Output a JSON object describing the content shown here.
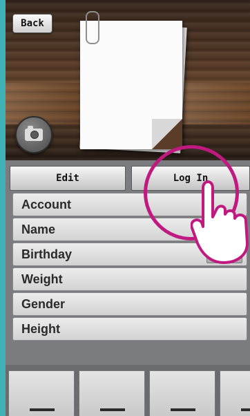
{
  "header": {
    "back_label": "Back",
    "icons": {
      "camera": "camera-icon",
      "paperclip": "paperclip-icon"
    }
  },
  "tabs": {
    "edit_label": "Edit",
    "login_label": "Log In"
  },
  "info_rows": [
    {
      "label": "Account"
    },
    {
      "label": "Name"
    },
    {
      "label": "Birthday",
      "has_toggle": true
    },
    {
      "label": "Weight"
    },
    {
      "label": "Gender"
    },
    {
      "label": "Height"
    }
  ],
  "bottom_tabs": [
    "tab-1",
    "tab-2",
    "tab-3",
    "tab-4"
  ],
  "overlay": {
    "highlight_color": "#c0197f",
    "icon": "tap-hand-icon"
  },
  "colors": {
    "frame_accent": "#3fb2b8",
    "background": "#7a7c80"
  }
}
